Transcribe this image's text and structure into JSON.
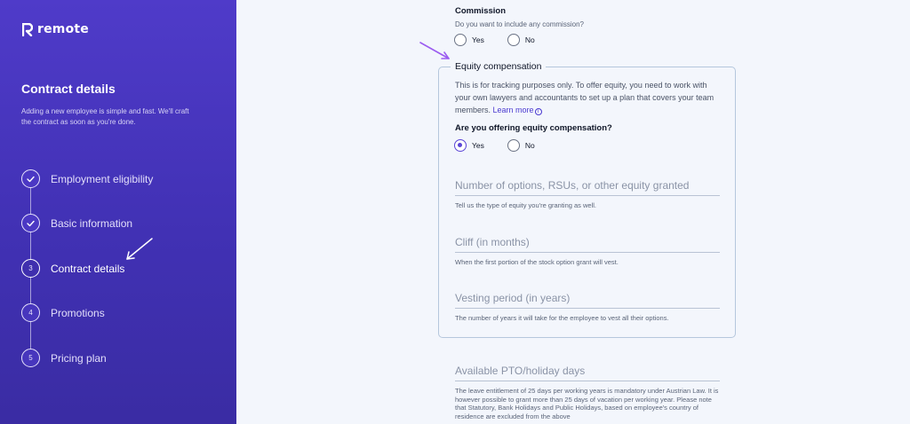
{
  "brand": {
    "name": "remote"
  },
  "sidebar": {
    "title": "Contract details",
    "description": "Adding a new employee is simple and fast. We'll craft the contract as soon as you're done.",
    "steps": [
      {
        "label": "Employment eligibility",
        "status": "done",
        "number": ""
      },
      {
        "label": "Basic information",
        "status": "done",
        "number": ""
      },
      {
        "label": "Contract details",
        "status": "current",
        "number": "3"
      },
      {
        "label": "Promotions",
        "status": "todo",
        "number": "4"
      },
      {
        "label": "Pricing plan",
        "status": "todo",
        "number": "5"
      }
    ]
  },
  "commission": {
    "label": "Commission",
    "question": "Do you want to include any commission?",
    "options": [
      "Yes",
      "No"
    ],
    "selected": null
  },
  "equity": {
    "legend": "Equity compensation",
    "description": "This is for tracking purposes only. To offer equity, you need to work with your own lawyers and accountants to set up a plan that covers your team members.",
    "learn_more": "Learn more",
    "question": "Are you offering equity compensation?",
    "options": [
      "Yes",
      "No"
    ],
    "selected": "Yes",
    "fields": [
      {
        "placeholder": "Number of options, RSUs, or other equity granted",
        "hint": "Tell us the type of equity you're granting as well."
      },
      {
        "placeholder": "Cliff (in months)",
        "hint": "When the first portion of the stock option grant will vest."
      },
      {
        "placeholder": "Vesting period (in years)",
        "hint": "The number of years it will take for the employee to vest all their options."
      }
    ]
  },
  "pto": {
    "placeholder": "Available PTO/holiday days",
    "note": "The leave entitlement of 25 days per working years is mandatory under Austrian Law. It is however possible to grant more than 25 days of vacation per working year. Please note that Statutory, Bank Holidays and Public Holidays, based on employee's country of residence are excluded from the above"
  },
  "colors": {
    "sidebar_bg": "#4534ba",
    "accent": "#5a45d6",
    "annotation_arrow": "#9b5cf0"
  }
}
